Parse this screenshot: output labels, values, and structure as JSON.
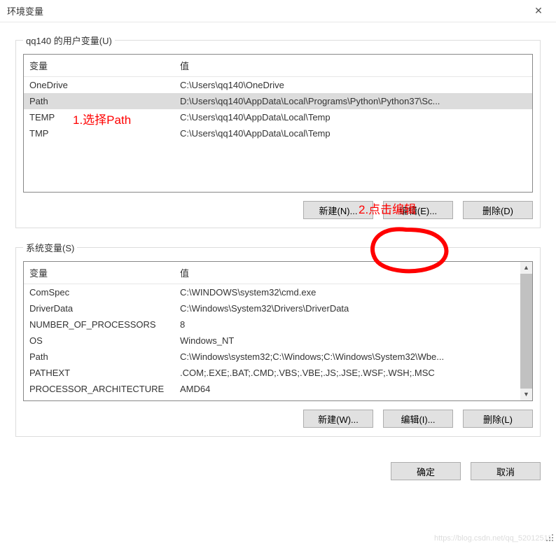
{
  "window": {
    "title": "环境变量"
  },
  "user_section": {
    "legend": "qq140 的用户变量(U)",
    "head_var": "变量",
    "head_val": "值",
    "rows": [
      {
        "var": "OneDrive",
        "val": "C:\\Users\\qq140\\OneDrive"
      },
      {
        "var": "Path",
        "val": "D:\\Users\\qq140\\AppData\\Local\\Programs\\Python\\Python37\\Sc..."
      },
      {
        "var": "TEMP",
        "val": "C:\\Users\\qq140\\AppData\\Local\\Temp"
      },
      {
        "var": "TMP",
        "val": "C:\\Users\\qq140\\AppData\\Local\\Temp"
      }
    ],
    "buttons": {
      "new": "新建(N)...",
      "edit": "编辑(E)...",
      "delete": "删除(D)"
    }
  },
  "system_section": {
    "legend": "系统变量(S)",
    "head_var": "变量",
    "head_val": "值",
    "rows": [
      {
        "var": "ComSpec",
        "val": "C:\\WINDOWS\\system32\\cmd.exe"
      },
      {
        "var": "DriverData",
        "val": "C:\\Windows\\System32\\Drivers\\DriverData"
      },
      {
        "var": "NUMBER_OF_PROCESSORS",
        "val": "8"
      },
      {
        "var": "OS",
        "val": "Windows_NT"
      },
      {
        "var": "Path",
        "val": "C:\\Windows\\system32;C:\\Windows;C:\\Windows\\System32\\Wbe..."
      },
      {
        "var": "PATHEXT",
        "val": ".COM;.EXE;.BAT;.CMD;.VBS;.VBE;.JS;.JSE;.WSF;.WSH;.MSC"
      },
      {
        "var": "PROCESSOR_ARCHITECTURE",
        "val": "AMD64"
      }
    ],
    "buttons": {
      "new": "新建(W)...",
      "edit": "编辑(I)...",
      "delete": "删除(L)"
    }
  },
  "dialog_buttons": {
    "ok": "确定",
    "cancel": "取消"
  },
  "annotations": {
    "one": "1.选择Path",
    "two": "2.点击编辑"
  },
  "watermark": "https://blog.csdn.net/qq_52012511"
}
